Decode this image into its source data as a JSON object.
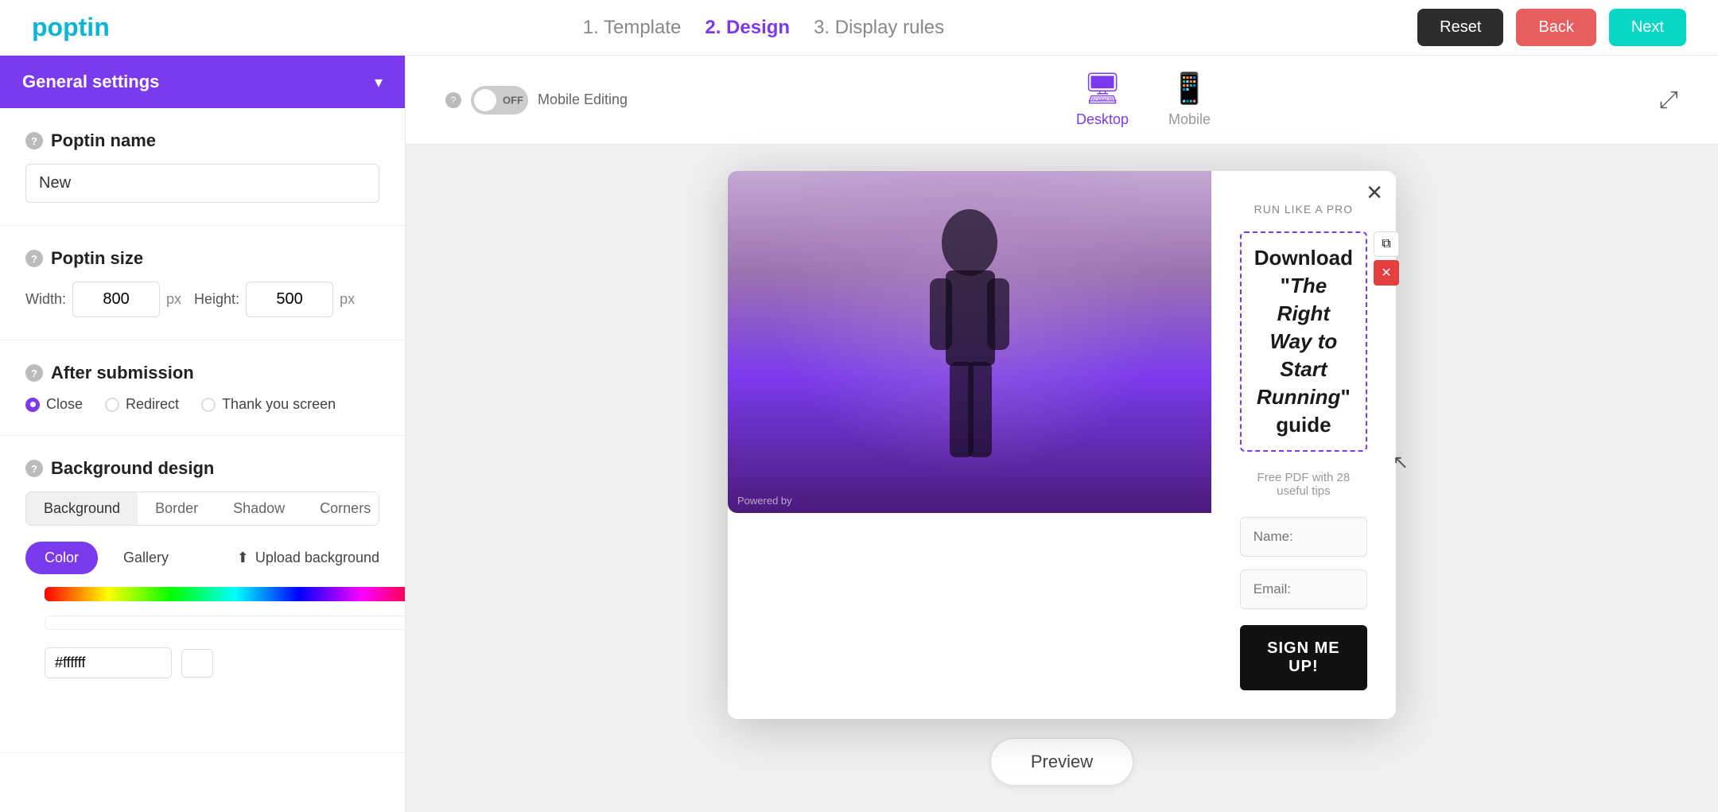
{
  "logo": {
    "text": "poptin"
  },
  "nav": {
    "step1": "1. Template",
    "step2": "2. Design",
    "step3": "3. Display rules",
    "reset": "Reset",
    "back": "Back",
    "next": "Next"
  },
  "left_panel": {
    "header": "General settings",
    "poptin_name_label": "Poptin name",
    "poptin_name_value": "New",
    "poptin_size_label": "Poptin size",
    "width_label": "Width:",
    "width_value": "800",
    "height_label": "Height:",
    "height_value": "500",
    "px": "px",
    "after_submission_label": "After submission",
    "submission_options": [
      "Close",
      "Redirect",
      "Thank you screen"
    ],
    "submission_selected": "Close",
    "bg_design_label": "Background design",
    "bg_tabs": [
      "Background",
      "Border",
      "Shadow",
      "Corners"
    ],
    "color_btn": "Color",
    "gallery_btn": "Gallery",
    "upload_btn": "Upload background",
    "hex_value": "#ffffff",
    "background_label": "Background"
  },
  "right_panel": {
    "mobile_editing_label": "Mobile Editing",
    "toggle_state": "OFF",
    "device_desktop": "Desktop",
    "device_mobile": "Mobile",
    "preview_btn": "Preview"
  },
  "popup": {
    "pre_title": "RUN LIKE A PRO",
    "title_part1": "Download \"",
    "title_italic": "The Right Way to Start Running",
    "title_part2": "\" guide",
    "subtitle": "Free PDF with 28 useful tips",
    "field_name": "Name:",
    "field_email": "Email:",
    "cta_btn": "SIGN ME UP!",
    "powered_by": "Powered by"
  }
}
